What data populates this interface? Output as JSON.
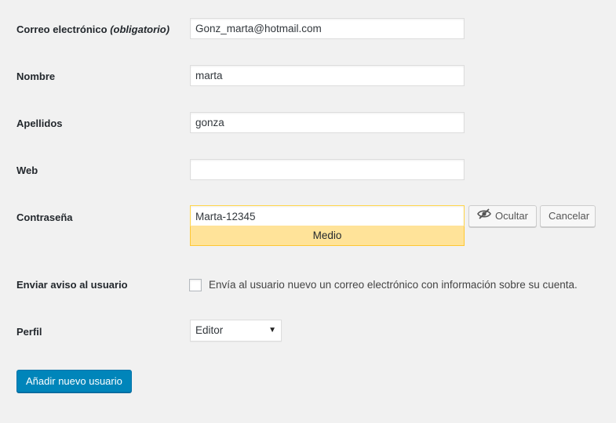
{
  "form": {
    "email": {
      "label": "Correo electrónico",
      "required_note": "(obligatorio)",
      "value": "Gonz_marta@hotmail.com"
    },
    "first_name": {
      "label": "Nombre",
      "value": "marta"
    },
    "last_name": {
      "label": "Apellidos",
      "value": "gonza"
    },
    "website": {
      "label": "Web",
      "value": ""
    },
    "password": {
      "label": "Contraseña",
      "value": "Marta-12345",
      "strength": "Medio",
      "hide_button": "Ocultar",
      "hide_icon": "eye-slash-icon",
      "cancel_button": "Cancelar"
    },
    "notify": {
      "label": "Enviar aviso al usuario",
      "checkbox_text": "Envía al usuario nuevo un correo electrónico con información sobre su cuenta.",
      "checked": false
    },
    "role": {
      "label": "Perfil",
      "selected": "Editor"
    },
    "submit_button": "Añadir nuevo usuario"
  },
  "colors": {
    "primary": "#0085ba",
    "strength_bg": "#ffe399",
    "strength_border": "#ffc733",
    "page_bg": "#f1f1f1"
  }
}
